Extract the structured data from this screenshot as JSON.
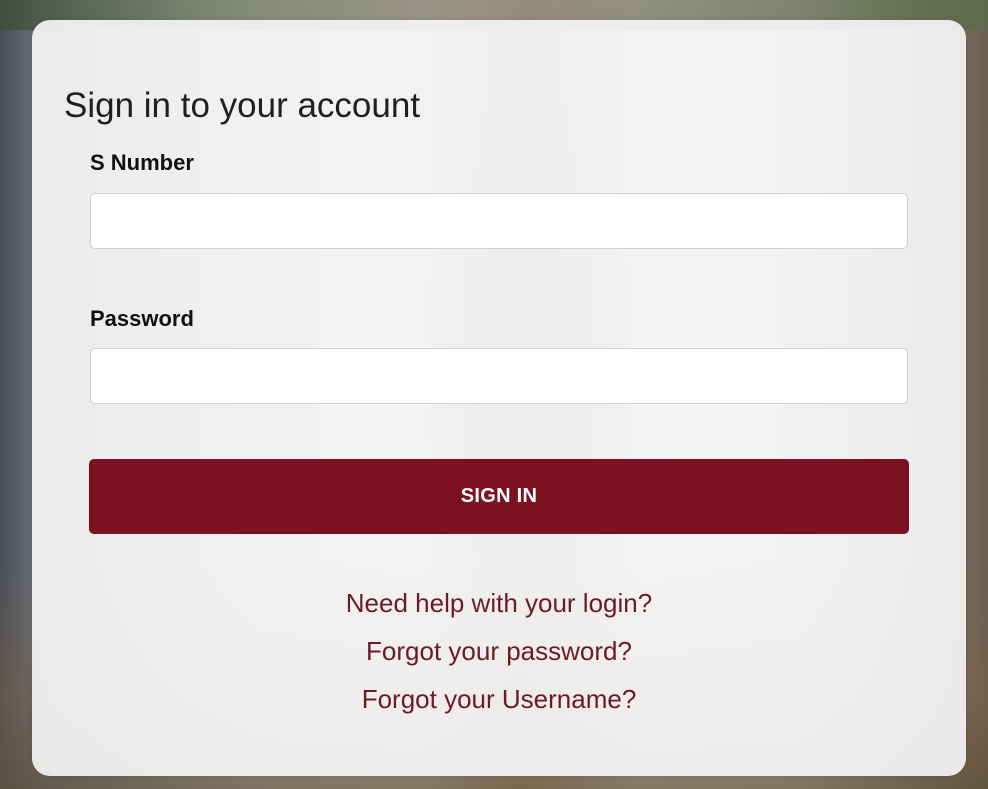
{
  "colors": {
    "accent": "#7b1121",
    "link": "#6e1a24",
    "card_background": "#f4f4f4"
  },
  "login": {
    "title": "Sign in to your account",
    "snumber_label": "S Number",
    "snumber_value": "",
    "password_label": "Password",
    "password_value": "",
    "submit_label": "SIGN IN"
  },
  "links": {
    "help": "Need help with your login?",
    "forgot_password": "Forgot your password?",
    "forgot_username": "Forgot your Username?"
  }
}
